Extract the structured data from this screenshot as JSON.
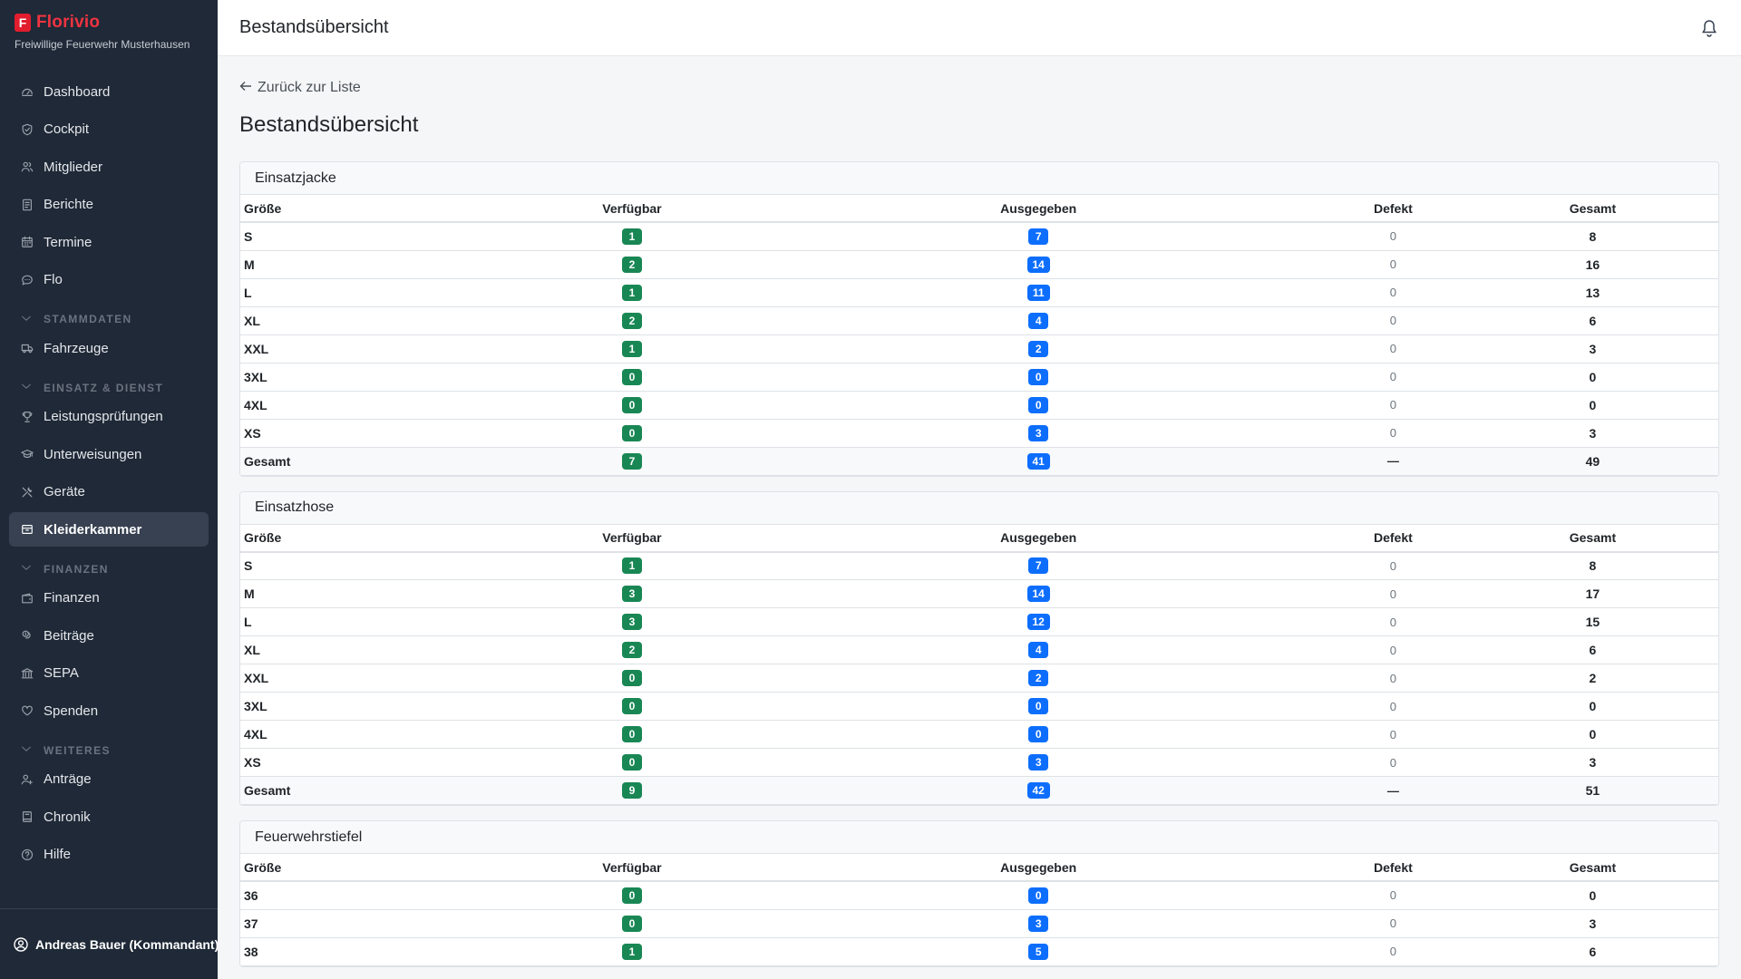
{
  "app": {
    "brand_letter": "F",
    "brand_name": "Florivio",
    "organization": "Freiwillige Feuerwehr Musterhausen",
    "accent_color": "#ef3340"
  },
  "sidebar": {
    "items_top": [
      {
        "label": "Dashboard",
        "icon": "dashboard-icon"
      },
      {
        "label": "Cockpit",
        "icon": "shield-icon"
      },
      {
        "label": "Mitglieder",
        "icon": "users-icon"
      },
      {
        "label": "Berichte",
        "icon": "document-icon"
      },
      {
        "label": "Termine",
        "icon": "calendar-icon"
      },
      {
        "label": "Flo",
        "icon": "chat-icon"
      }
    ],
    "sections": [
      {
        "title": "STAMMDATEN",
        "items": [
          {
            "label": "Fahrzeuge",
            "icon": "truck-icon"
          }
        ]
      },
      {
        "title": "EINSATZ & DIENST",
        "items": [
          {
            "label": "Leistungsprüfungen",
            "icon": "trophy-icon"
          },
          {
            "label": "Unterweisungen",
            "icon": "graduation-icon"
          },
          {
            "label": "Geräte",
            "icon": "tools-icon"
          },
          {
            "label": "Kleiderkammer",
            "icon": "box-icon",
            "active": true
          }
        ]
      },
      {
        "title": "FINANZEN",
        "items": [
          {
            "label": "Finanzen",
            "icon": "wallet-icon"
          },
          {
            "label": "Beiträge",
            "icon": "coins-icon"
          },
          {
            "label": "SEPA",
            "icon": "bank-icon"
          },
          {
            "label": "Spenden",
            "icon": "heart-icon"
          }
        ]
      },
      {
        "title": "WEITERES",
        "items": [
          {
            "label": "Anträge",
            "icon": "person-add-icon"
          },
          {
            "label": "Chronik",
            "icon": "book-icon"
          },
          {
            "label": "Hilfe",
            "icon": "help-icon"
          }
        ]
      }
    ],
    "user": "Andreas Bauer (Kommandant)"
  },
  "topbar": {
    "title": "Bestandsübersicht",
    "bell_icon": "bell-icon"
  },
  "main": {
    "back_label": "Zurück zur Liste",
    "page_title": "Bestandsübersicht",
    "columns": [
      "Größe",
      "Verfügbar",
      "Ausgegeben",
      "Defekt",
      "Gesamt"
    ],
    "badge_colors": {
      "available": "#198754",
      "issued": "#0d6efd"
    },
    "cards": [
      {
        "title": "Einsatzjacke",
        "rows": [
          {
            "size": "S",
            "available": "1",
            "issued": "7",
            "defect": "0",
            "total": "8"
          },
          {
            "size": "M",
            "available": "2",
            "issued": "14",
            "defect": "0",
            "total": "16"
          },
          {
            "size": "L",
            "available": "1",
            "issued": "11",
            "defect": "0",
            "total": "13"
          },
          {
            "size": "XL",
            "available": "2",
            "issued": "4",
            "defect": "0",
            "total": "6"
          },
          {
            "size": "XXL",
            "available": "1",
            "issued": "2",
            "defect": "0",
            "total": "3"
          },
          {
            "size": "3XL",
            "available": "0",
            "issued": "0",
            "defect": "0",
            "total": "0"
          },
          {
            "size": "4XL",
            "available": "0",
            "issued": "0",
            "defect": "0",
            "total": "0"
          },
          {
            "size": "XS",
            "available": "0",
            "issued": "3",
            "defect": "0",
            "total": "3"
          }
        ],
        "sum": {
          "size": "Gesamt",
          "available": "7",
          "issued": "41",
          "defect": "—",
          "total": "49"
        }
      },
      {
        "title": "Einsatzhose",
        "rows": [
          {
            "size": "S",
            "available": "1",
            "issued": "7",
            "defect": "0",
            "total": "8"
          },
          {
            "size": "M",
            "available": "3",
            "issued": "14",
            "defect": "0",
            "total": "17"
          },
          {
            "size": "L",
            "available": "3",
            "issued": "12",
            "defect": "0",
            "total": "15"
          },
          {
            "size": "XL",
            "available": "2",
            "issued": "4",
            "defect": "0",
            "total": "6"
          },
          {
            "size": "XXL",
            "available": "0",
            "issued": "2",
            "defect": "0",
            "total": "2"
          },
          {
            "size": "3XL",
            "available": "0",
            "issued": "0",
            "defect": "0",
            "total": "0"
          },
          {
            "size": "4XL",
            "available": "0",
            "issued": "0",
            "defect": "0",
            "total": "0"
          },
          {
            "size": "XS",
            "available": "0",
            "issued": "3",
            "defect": "0",
            "total": "3"
          }
        ],
        "sum": {
          "size": "Gesamt",
          "available": "9",
          "issued": "42",
          "defect": "—",
          "total": "51"
        }
      },
      {
        "title": "Feuerwehrstiefel",
        "rows": [
          {
            "size": "36",
            "available": "0",
            "issued": "0",
            "defect": "0",
            "total": "0"
          },
          {
            "size": "37",
            "available": "0",
            "issued": "3",
            "defect": "0",
            "total": "3"
          },
          {
            "size": "38",
            "available": "1",
            "issued": "5",
            "defect": "0",
            "total": "6"
          }
        ]
      }
    ]
  }
}
